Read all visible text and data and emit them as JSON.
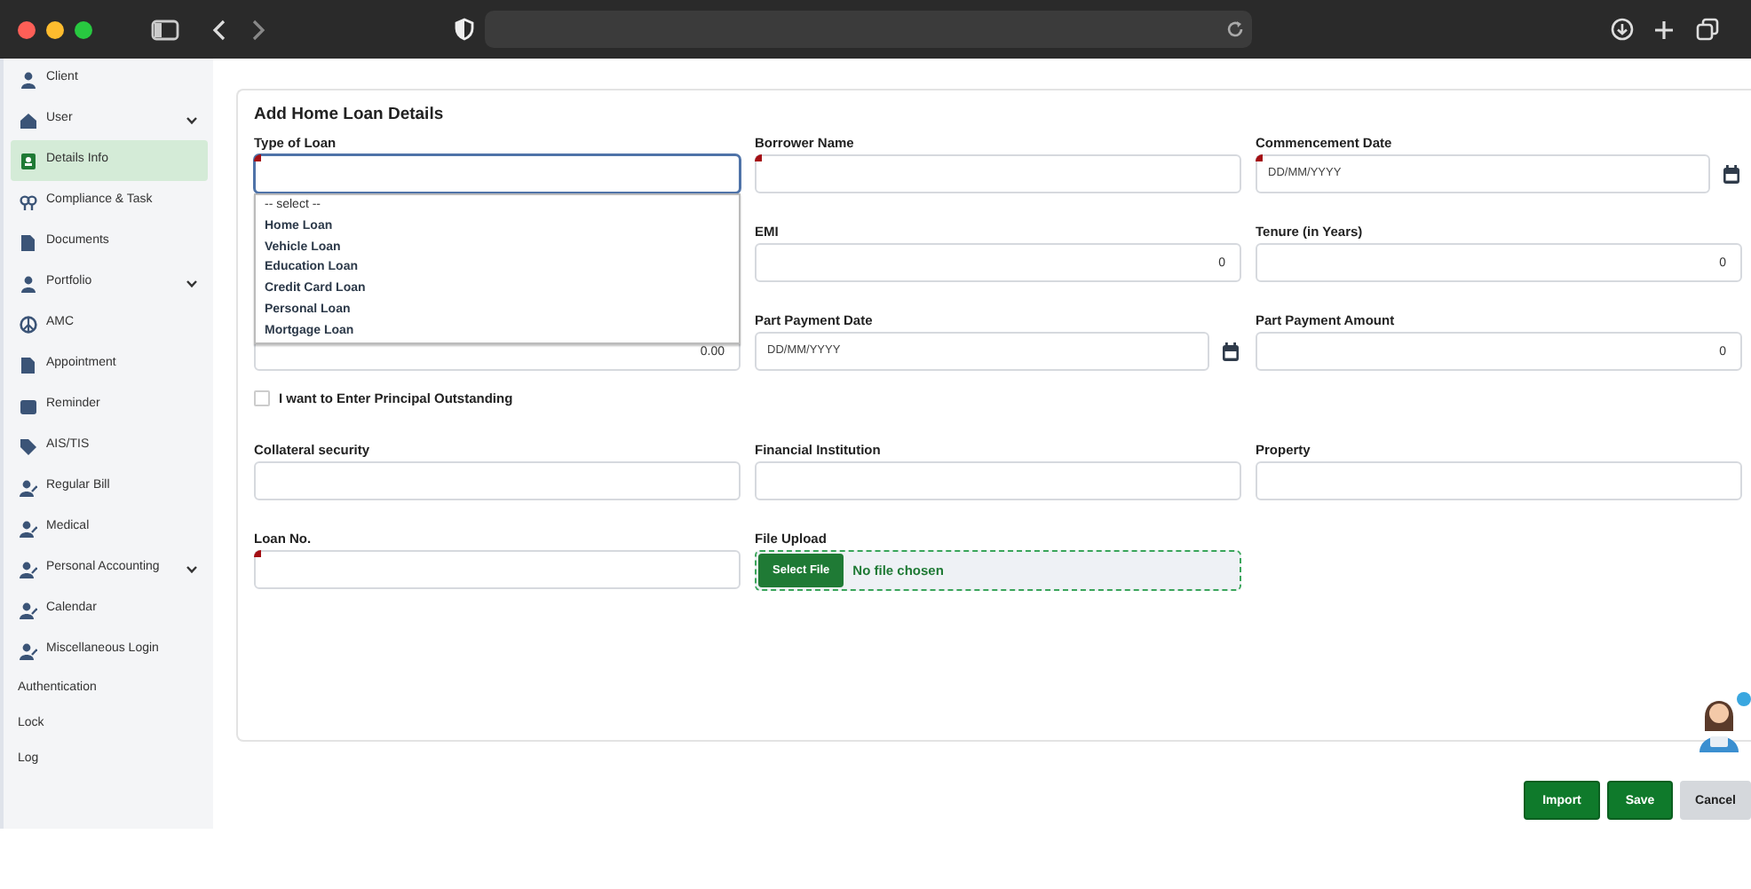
{
  "sidebar": {
    "items": [
      {
        "label": "Client",
        "has_submenu": false,
        "selected": false
      },
      {
        "label": "User",
        "has_submenu": true,
        "selected": false
      },
      {
        "label": "Details Info",
        "has_submenu": false,
        "selected": true
      },
      {
        "label": "Compliance & Task",
        "has_submenu": false,
        "selected": false
      },
      {
        "label": "Documents",
        "has_submenu": false,
        "selected": false
      },
      {
        "label": "Portfolio",
        "has_submenu": true,
        "selected": false
      },
      {
        "label": "AMC",
        "has_submenu": false,
        "selected": false
      },
      {
        "label": "Appointment",
        "has_submenu": false,
        "selected": false
      },
      {
        "label": "Reminder",
        "has_submenu": false,
        "selected": false
      },
      {
        "label": "AIS/TIS",
        "has_submenu": false,
        "selected": false
      },
      {
        "label": "Regular Bill",
        "has_submenu": false,
        "selected": false
      },
      {
        "label": "Medical",
        "has_submenu": false,
        "selected": false
      },
      {
        "label": "Personal Accounting",
        "has_submenu": true,
        "selected": false
      },
      {
        "label": "Calendar",
        "has_submenu": false,
        "selected": false
      },
      {
        "label": "Miscellaneous Login",
        "has_submenu": false,
        "selected": false
      },
      {
        "label": "Authentication",
        "has_submenu": false,
        "selected": false
      },
      {
        "label": "Lock",
        "has_submenu": false,
        "selected": false
      },
      {
        "label": "Log",
        "has_submenu": false,
        "selected": false
      }
    ]
  },
  "form": {
    "title": "Add Home Loan Details",
    "fields": [
      {
        "label": "Type of Loan",
        "kind": "select",
        "required": true,
        "focused": true,
        "expanded": true,
        "options": [
          "-- select --",
          "Home Loan",
          "Vehicle Loan",
          "Education Loan",
          "Credit Card Loan",
          "Personal Loan",
          "Mortgage Loan"
        ]
      },
      {
        "label": "Borrower Name",
        "kind": "text",
        "required": true,
        "focused": false
      },
      {
        "label": "Commencement Date",
        "kind": "date",
        "placeholder": "DD/MM/YYYY",
        "required": true,
        "focused": false
      },
      {
        "label": "EMI",
        "kind": "number",
        "value": "0",
        "required": false,
        "focused": false
      },
      {
        "label": "Tenure (in Years)",
        "kind": "number",
        "value": "0",
        "required": false,
        "focused": false
      },
      {
        "kind": "number",
        "value": "0.00",
        "required": false,
        "focused": false
      },
      {
        "label": "Part Payment Date",
        "kind": "date",
        "placeholder": "DD/MM/YYYY",
        "required": false,
        "focused": false
      },
      {
        "label": "Part Payment Amount",
        "kind": "number",
        "value": "0",
        "required": false,
        "focused": false
      }
    ],
    "checkbox": {
      "label": "I want to Enter Principal Outstanding",
      "checked": false
    },
    "fields2": [
      {
        "label": "Collateral security",
        "kind": "text",
        "required": false,
        "focused": false
      },
      {
        "label": "Financial Institution",
        "kind": "text",
        "required": false,
        "focused": false
      },
      {
        "label": "Property",
        "kind": "text",
        "required": false,
        "focused": false
      },
      {
        "label": "Loan No.",
        "kind": "text",
        "required": true,
        "focused": false
      },
      {
        "label": "File Upload",
        "kind": "file",
        "button": "Select File",
        "status": "No file chosen"
      }
    ]
  },
  "buttons": [
    {
      "label": "Import",
      "kind": "primary"
    },
    {
      "label": "Save",
      "kind": "primary"
    },
    {
      "label": "Cancel",
      "kind": "secondary"
    }
  ]
}
